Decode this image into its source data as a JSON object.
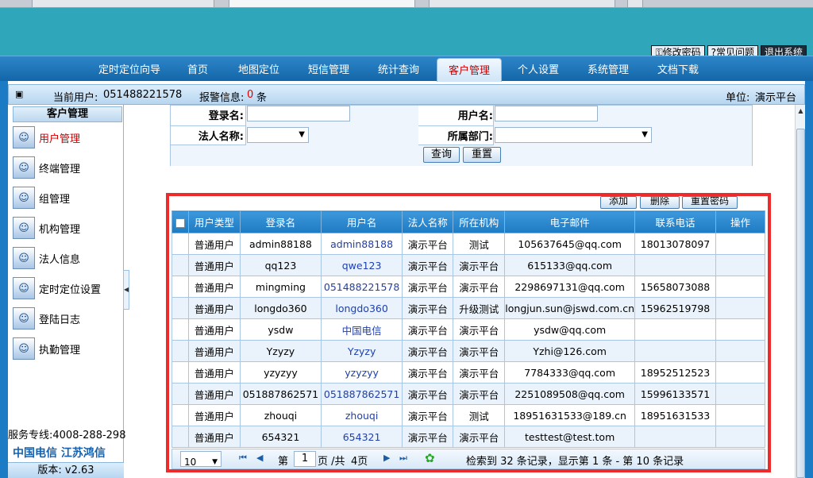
{
  "nav": {
    "items": [
      "定时定位向导",
      "首页",
      "地图定位",
      "短信管理",
      "统计查询",
      "客户管理",
      "个人设置",
      "系统管理",
      "文档下载"
    ],
    "active_index": 5
  },
  "top_buttons": {
    "change_password": "修改密码",
    "faq": "常见问题",
    "logout": "退出系统"
  },
  "status": {
    "current_user_label": "当前用户:",
    "current_user": "051488221578",
    "alarm_label": "报警信息:",
    "alarm_count": "0",
    "alarm_unit": "条",
    "unit_label": "单位:",
    "unit": "演示平台"
  },
  "sidebar": {
    "title": "客户管理",
    "items": [
      {
        "label": "用户管理",
        "icon": "user-manage-icon",
        "active": true
      },
      {
        "label": "终端管理",
        "icon": "terminal-icon",
        "active": false
      },
      {
        "label": "组管理",
        "icon": "group-icon",
        "active": false
      },
      {
        "label": "机构管理",
        "icon": "org-icon",
        "active": false
      },
      {
        "label": "法人信息",
        "icon": "legal-person-icon",
        "active": false
      },
      {
        "label": "定时定位设置",
        "icon": "timer-locate-icon",
        "active": false
      },
      {
        "label": "登陆日志",
        "icon": "login-log-icon",
        "active": false
      },
      {
        "label": "执勤管理",
        "icon": "duty-icon",
        "active": false
      }
    ],
    "hotline": "服务专线:4008-288-298",
    "logo_text": "中国电信 江苏鸿信",
    "version": "版本: v2.63"
  },
  "form": {
    "login_name_label": "登录名:",
    "login_name_value": "",
    "user_name_label": "用户名:",
    "user_name_value": "",
    "legal_name_label": "法人名称:",
    "legal_name_value": "",
    "dept_label": "所属部门:",
    "dept_value": "",
    "query_button": "查询",
    "reset_button": "重置"
  },
  "toolbar": {
    "add": "添加",
    "delete": "删除",
    "reset_password": "重置密码"
  },
  "table": {
    "headers": [
      "用户类型",
      "登录名",
      "用户名",
      "法人名称",
      "所在机构",
      "电子邮件",
      "联系电话",
      "操作"
    ],
    "rows": [
      [
        "普通用户",
        "admin88188",
        "admin88188",
        "演示平台",
        "测试",
        "105637645@qq.com",
        "18013078097",
        ""
      ],
      [
        "普通用户",
        "qq123",
        "qwe123",
        "演示平台",
        "演示平台",
        "615133@qq.com",
        "",
        ""
      ],
      [
        "普通用户",
        "mingming",
        "051488221578",
        "演示平台",
        "演示平台",
        "2298697131@qq.com",
        "15658073088",
        ""
      ],
      [
        "普通用户",
        "longdo360",
        "longdo360",
        "演示平台",
        "升级测试",
        "longjun.sun@jswd.com.cn",
        "15962519798",
        ""
      ],
      [
        "普通用户",
        "ysdw",
        "中国电信",
        "演示平台",
        "演示平台",
        "ysdw@qq.com",
        "",
        ""
      ],
      [
        "普通用户",
        "Yzyzy",
        "Yzyzy",
        "演示平台",
        "演示平台",
        "Yzhi@126.com",
        "",
        ""
      ],
      [
        "普通用户",
        "yzyzyy",
        "yzyzyy",
        "演示平台",
        "演示平台",
        "7784333@qq.com",
        "18952512523",
        ""
      ],
      [
        "普通用户",
        "051887862571",
        "051887862571",
        "演示平台",
        "演示平台",
        "2251089508@qq.com",
        "15996133571",
        ""
      ],
      [
        "普通用户",
        "zhouqi",
        "zhouqi",
        "演示平台",
        "测试",
        "18951631533@189.cn",
        "18951631533",
        ""
      ],
      [
        "普通用户",
        "654321",
        "654321",
        "演示平台",
        "演示平台",
        "testtest@test.tom",
        "",
        ""
      ]
    ]
  },
  "pager": {
    "page_size": "10",
    "page_label": "第",
    "page": "1",
    "total_label": "页 /共",
    "total_pages": "4页",
    "summary": "检索到 32 条记录，显示第 1 条 - 第 10 条记录"
  }
}
